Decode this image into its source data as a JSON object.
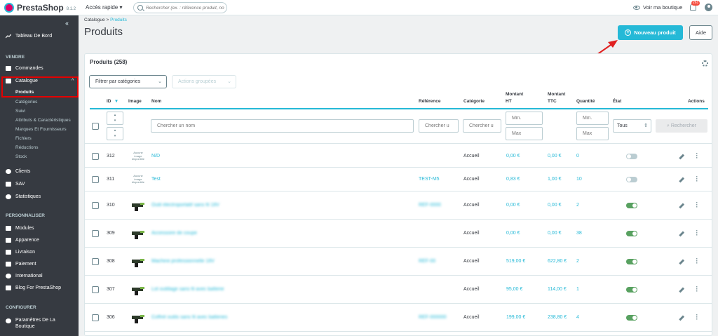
{
  "header": {
    "brand": "PrestaShop",
    "version": "8.1.2",
    "quick_access": "Accès rapide ▾",
    "search_placeholder": "Rechercher (ex. : référence produit, no",
    "view_shop": "Voir ma boutique",
    "notif_count": "261"
  },
  "sidebar": {
    "collapse": "«",
    "dashboard": "Tableau De Bord",
    "section_sell": "VENDRE",
    "orders": "Commandes",
    "catalog": "Catalogue",
    "catalog_chevron": "^",
    "catalog_sub": [
      "Produits",
      "Catégories",
      "Suivi",
      "Attributs & Caractéristiques",
      "Marques Et Fournisseurs",
      "Fichiers",
      "Réductions",
      "Stock"
    ],
    "customers": "Clients",
    "sav": "SAV",
    "stats": "Statistiques",
    "section_custom": "PERSONNALISER",
    "modules": "Modules",
    "appearance": "Apparence",
    "shipping": "Livraison",
    "payment": "Paiement",
    "international": "International",
    "blog": "Blog For PrestaShop",
    "section_config": "CONFIGURER",
    "shop_params_1": "Paramètres De La",
    "shop_params_2": "Boutique"
  },
  "page": {
    "breadcrumb_root": "Catalogue",
    "breadcrumb_sep": ">",
    "breadcrumb_current": "Produits",
    "title": "Produits",
    "new_product": "Nouveau produit",
    "help": "Aide"
  },
  "panel": {
    "title": "Produits (258)",
    "filter_categories": "Filtrer par catégories",
    "bulk_actions": "Actions groupées",
    "columns": {
      "id": "ID",
      "id_sort": "▾",
      "image": "Image",
      "name": "Nom",
      "reference": "Référence",
      "category": "Catégorie",
      "price_ht_1": "Montant",
      "price_ht_2": "HT",
      "price_ttc_1": "Montant",
      "price_ttc_2": "TTC",
      "quantity": "Quantité",
      "state": "État",
      "actions": "Actions"
    },
    "filters": {
      "name_placeholder": "Chercher un nom",
      "ref_placeholder": "Chercher u",
      "cat_placeholder": "Chercher u",
      "min": "Min.",
      "max": "Max",
      "status_value": "Tous",
      "search_button": "Rechercher"
    },
    "no_image_text": "Aucune image disponible",
    "products": [
      {
        "id": "312",
        "name": "N/D",
        "reference": "",
        "category": "Accueil",
        "price_ht": "0,00 €",
        "price_ttc": "0,00 €",
        "quantity": "0",
        "active": false,
        "has_image": false,
        "blurred": false
      },
      {
        "id": "311",
        "name": "Test",
        "reference": "TEST-M5",
        "category": "Accueil",
        "price_ht": "0,83 €",
        "price_ttc": "1,00 €",
        "quantity": "10",
        "active": false,
        "has_image": false,
        "blurred": false
      },
      {
        "id": "310",
        "name": "Outil électroportatif sans fil 18V",
        "reference": "REF-0000",
        "category": "Accueil",
        "price_ht": "0,00 €",
        "price_ttc": "0,00 €",
        "quantity": "2",
        "active": true,
        "has_image": true,
        "blurred": true
      },
      {
        "id": "309",
        "name": "Accessoire de coupe",
        "reference": "",
        "category": "Accueil",
        "price_ht": "0,00 €",
        "price_ttc": "0,00 €",
        "quantity": "38",
        "active": true,
        "has_image": true,
        "blurred": true
      },
      {
        "id": "308",
        "name": "Machine professionnelle 18V",
        "reference": "REF-00",
        "category": "Accueil",
        "price_ht": "519,00 €",
        "price_ttc": "622,80 €",
        "quantity": "2",
        "active": true,
        "has_image": true,
        "blurred": true
      },
      {
        "id": "307",
        "name": "Lot outillage sans fil avec batterie",
        "reference": "",
        "category": "Accueil",
        "price_ht": "95,00 €",
        "price_ttc": "114,00 €",
        "quantity": "1",
        "active": true,
        "has_image": true,
        "blurred": true
      },
      {
        "id": "306",
        "name": "Coffret outils sans fil avec batteries",
        "reference": "REF-000000",
        "category": "Accueil",
        "price_ht": "199,00 €",
        "price_ttc": "238,80 €",
        "quantity": "4",
        "active": true,
        "has_image": true,
        "blurred": true
      }
    ]
  },
  "colors": {
    "accent": "#25b9d7",
    "sidebar_bg": "#363a41",
    "highlight_box": "#e40000",
    "toggle_on": "#58a160",
    "annotation_arrow": "#e02020"
  }
}
